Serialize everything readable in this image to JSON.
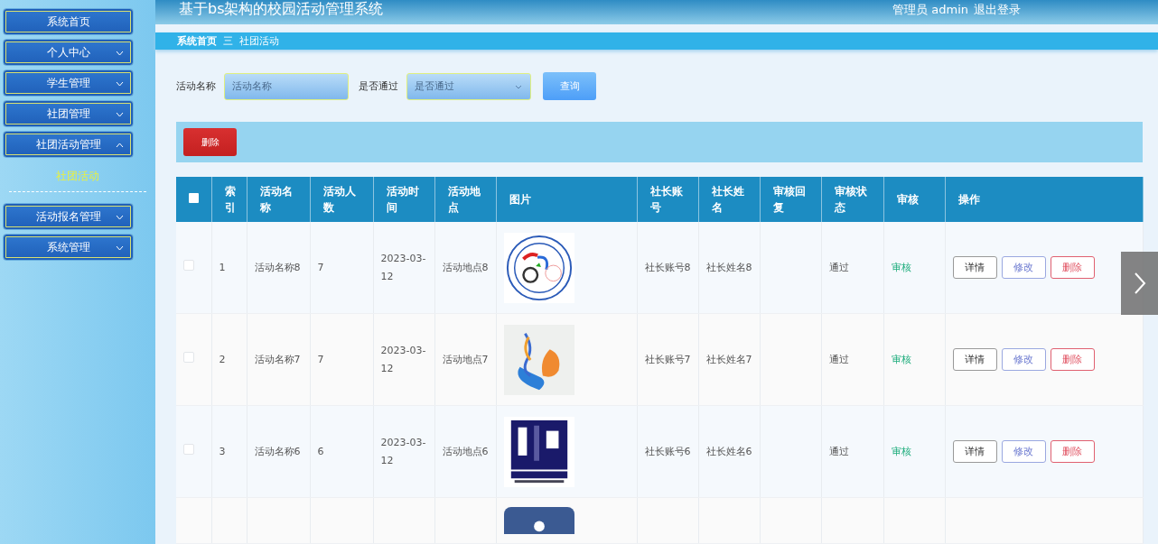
{
  "header": {
    "title": "基于bs架构的校园活动管理系统",
    "user_label": "管理员 admin",
    "logout": "退出登录"
  },
  "sidebar": {
    "items": [
      {
        "label": "系统首页",
        "kind": "link"
      },
      {
        "label": "个人中心",
        "kind": "menu",
        "expanded": false
      },
      {
        "label": "学生管理",
        "kind": "menu",
        "expanded": false
      },
      {
        "label": "社团管理",
        "kind": "menu",
        "expanded": false
      },
      {
        "label": "社团活动管理",
        "kind": "menu",
        "expanded": true,
        "children": [
          {
            "label": "社团活动",
            "selected": true
          }
        ]
      },
      {
        "label": "活动报名管理",
        "kind": "menu",
        "expanded": false
      },
      {
        "label": "系统管理",
        "kind": "menu",
        "expanded": false
      }
    ]
  },
  "breadcrumb": {
    "items": [
      "系统首页",
      "社团活动"
    ],
    "separator": "三"
  },
  "search": {
    "fields": [
      {
        "label": "活动名称",
        "placeholder": "活动名称",
        "kind": "input"
      },
      {
        "label": "是否通过",
        "placeholder": "是否通过",
        "kind": "select"
      }
    ],
    "button": "查询"
  },
  "toolbar": {
    "delete_button": "删除"
  },
  "table": {
    "columns": [
      {
        "kind": "checkbox",
        "checked": false
      },
      {
        "kind": "text",
        "label": "索引"
      },
      {
        "kind": "text",
        "label": "活动名称"
      },
      {
        "kind": "text",
        "label": "活动人数"
      },
      {
        "kind": "text",
        "label": "活动时间"
      },
      {
        "kind": "text",
        "label": "活动地点"
      },
      {
        "kind": "text",
        "label": "图片"
      },
      {
        "kind": "text",
        "label": "社长账号"
      },
      {
        "kind": "text",
        "label": "社长姓名"
      },
      {
        "kind": "text",
        "label": "审核回复"
      },
      {
        "kind": "text",
        "label": "审核状态"
      },
      {
        "kind": "text",
        "label": "审核"
      },
      {
        "kind": "text",
        "label": "操作"
      }
    ],
    "rows": [
      {
        "kind": "full",
        "checked": false,
        "index": "1",
        "name": "活动名称8",
        "count": "7",
        "time": "2023-03-12",
        "place": "活动地点8",
        "picture": {
          "kind": "picture"
        },
        "account": "社长账号8",
        "leader": "社长姓名8",
        "status": "通过",
        "review": "审核",
        "actions": [
          {
            "label": "详情",
            "kind": "default"
          },
          {
            "label": "修改",
            "kind": "primary"
          },
          {
            "label": "删除",
            "kind": "danger"
          }
        ]
      },
      {
        "kind": "full",
        "checked": false,
        "index": "2",
        "name": "活动名称7",
        "count": "7",
        "time": "2023-03-12",
        "place": "活动地点7",
        "picture": {
          "kind": "picture"
        },
        "account": "社长账号7",
        "leader": "社长姓名7",
        "status": "通过",
        "review": "审核",
        "actions": [
          {
            "label": "详情",
            "kind": "default"
          },
          {
            "label": "修改",
            "kind": "primary"
          },
          {
            "label": "删除",
            "kind": "danger"
          }
        ]
      },
      {
        "kind": "full",
        "checked": false,
        "index": "3",
        "name": "活动名称6",
        "count": "6",
        "time": "2023-03-12",
        "place": "活动地点6",
        "picture": {
          "kind": "picture"
        },
        "account": "社长账号6",
        "leader": "社长姓名6",
        "status": "通过",
        "review": "审核",
        "actions": [
          {
            "label": "详情",
            "kind": "default"
          },
          {
            "label": "修改",
            "kind": "primary"
          },
          {
            "label": "删除",
            "kind": "danger"
          }
        ]
      },
      {
        "kind": "partial",
        "picture": {
          "kind": "picture"
        }
      }
    ]
  }
}
